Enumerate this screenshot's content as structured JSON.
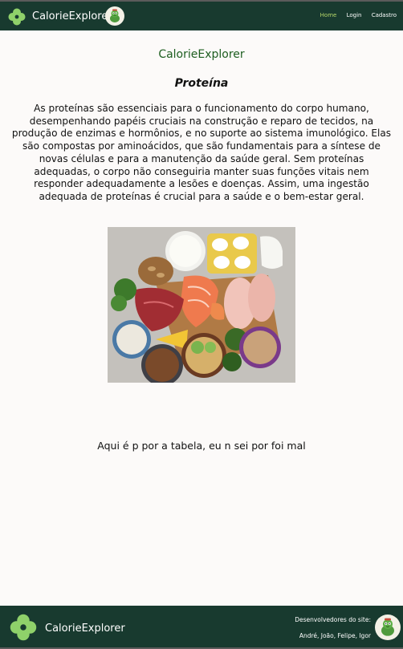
{
  "header": {
    "brand": "CalorieExplorer",
    "nav": [
      {
        "label": "Home",
        "active": true
      },
      {
        "label": "Login",
        "active": false
      },
      {
        "label": "Cadastro",
        "active": false
      }
    ]
  },
  "main": {
    "site_name": "CalorieExplorer",
    "section_title": "Proteína",
    "intro": "As proteínas são essenciais para o funcionamento do corpo humano, desempenhando papéis cruciais na construção e reparo de tecidos, na produção de enzimas e hormônios, e no suporte ao sistema imunológico. Elas são compostas por aminoácidos, que são fundamentais para a síntese de novas células e para a manutenção da saúde geral. Sem proteínas adequadas, o corpo não conseguiria manter suas funções vitais nem responder adequadamente a lesões e doenças. Assim, uma ingestão adequada de proteínas é crucial para a saúde e o bem-estar geral.",
    "caption": "Aqui é p por a tabela, eu n sei por foi mal"
  },
  "footer": {
    "brand": "CalorieExplorer",
    "developers_title": "Desenvolvedores do site:",
    "developers_names": "André, João, Felipe, Igor"
  },
  "colors": {
    "header_bg": "#183a2f",
    "accent_green": "#1d5e20",
    "nav_active": "#b7d86a",
    "clover": "#8fd16a",
    "page_bg": "#fcfaf9"
  },
  "icons": {
    "logo": "clover-icon",
    "mascot": "mascot-avatar"
  }
}
